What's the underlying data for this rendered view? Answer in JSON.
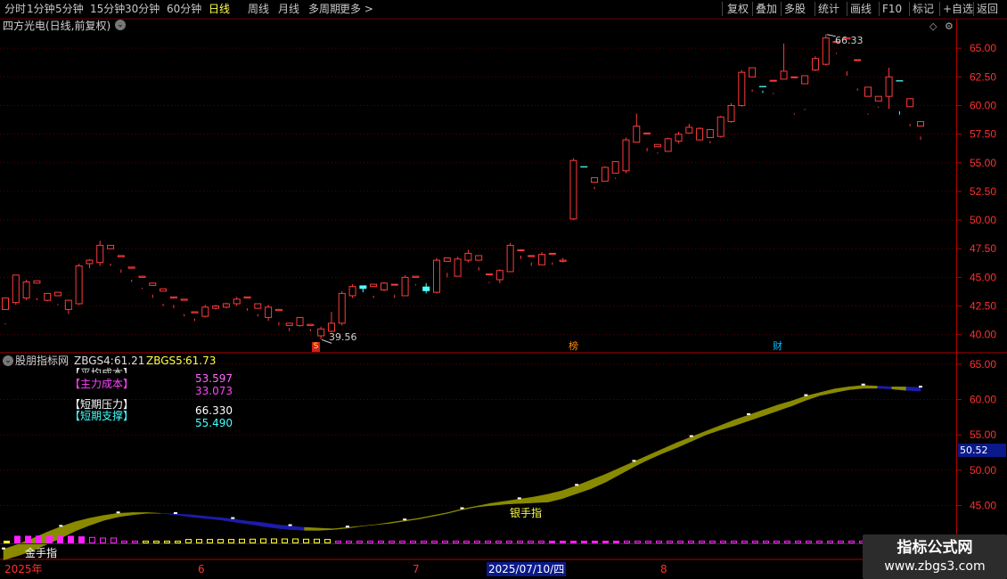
{
  "toolbar": {
    "periods": [
      "分时",
      "1分钟",
      "5分钟",
      "15分钟",
      "30分钟",
      "60分钟",
      "日线",
      "周线",
      "月线",
      "多周期",
      "更多"
    ],
    "active": "日线",
    "right": [
      "复权",
      "叠加",
      "多股",
      "统计",
      "画线",
      "F10",
      "标记",
      "+自选",
      "返回"
    ]
  },
  "main_header": {
    "title": "四方光电(日线,前复权)"
  },
  "indicator_header": {
    "name": "股朋指标网",
    "zb4_label": "ZBGS4:",
    "zb4_value": "61.21",
    "zb5_label": "ZBGS5:",
    "zb5_value": "61.73"
  },
  "info_rows": {
    "clip_label": "【平均成本】",
    "main_cost_label": "【主力成本】",
    "clip_value": "53.597",
    "main_cost_value": "33.073",
    "short_pressure_label": "【短期压力】",
    "short_support_label": "【短期支撑】",
    "short_pressure_value": "66.330",
    "short_support_value": "55.490"
  },
  "annotations": {
    "silver_label": "银手指",
    "gold_label": "金手指",
    "low_mark": "39.56",
    "high_mark": "66.33",
    "marker_s": "S",
    "marker_bang": "榜",
    "marker_cai": "财",
    "price_tag": "50.52"
  },
  "date_axis": {
    "year": "2025年",
    "m6": "6",
    "m7": "7",
    "cursor_date": "2025/07/10/四",
    "m8": "8"
  },
  "watermark": {
    "title": "指标公式网",
    "url": "www.zbgs3.com"
  },
  "colors": {
    "up": "#ff3b3b",
    "down": "#54ffff",
    "band_up": "#8a8a00",
    "band_down": "#1c1ca8",
    "grid": "#5a0000"
  },
  "chart_data": [
    {
      "type": "candlestick",
      "title": "四方光电(日线,前复权)",
      "ylim": [
        38.5,
        67.5
      ],
      "yticks": [
        40.0,
        42.5,
        45.0,
        47.5,
        50.0,
        52.5,
        55.0,
        57.5,
        60.0,
        62.5,
        65.0
      ],
      "ohlc": [
        [
          42.2,
          43.2,
          41.0,
          40.9
        ],
        [
          42.8,
          45.2,
          42.6,
          42.8
        ],
        [
          43.2,
          44.6,
          43.0,
          44.8
        ],
        [
          44.5,
          44.7,
          43.0,
          43.2
        ],
        [
          43.0,
          43.6,
          42.9,
          43.6
        ],
        [
          43.4,
          43.7,
          42.6,
          42.7
        ],
        [
          42.2,
          43.0,
          41.8,
          42.6
        ],
        [
          42.7,
          46.0,
          42.6,
          46.2
        ],
        [
          46.2,
          46.5,
          45.8,
          46.6
        ],
        [
          46.3,
          47.8,
          46.0,
          48.2
        ],
        [
          47.5,
          47.8,
          46.2,
          46.0
        ],
        [
          46.8,
          46.9,
          45.7,
          45.4
        ],
        [
          45.8,
          45.9,
          44.8,
          44.6
        ],
        [
          45.0,
          45.1,
          44.1,
          44.0
        ],
        [
          44.3,
          44.5,
          43.5,
          43.2
        ],
        [
          43.8,
          44.0,
          42.7,
          42.5
        ],
        [
          43.2,
          43.3,
          42.6,
          42.3
        ],
        [
          43.0,
          43.1,
          41.8,
          41.6
        ],
        [
          41.9,
          42.0,
          41.4,
          41.2
        ],
        [
          41.6,
          42.4,
          41.5,
          42.6
        ],
        [
          42.3,
          42.5,
          42.2,
          42.6
        ],
        [
          42.4,
          42.7,
          42.3,
          42.8
        ],
        [
          42.7,
          43.1,
          42.5,
          43.3
        ],
        [
          43.2,
          43.3,
          42.3,
          42.1
        ],
        [
          42.3,
          42.7,
          41.8,
          41.6
        ],
        [
          41.5,
          42.4,
          41.2,
          42.6
        ],
        [
          42.1,
          42.2,
          41.1,
          40.8
        ],
        [
          40.8,
          41.0,
          40.6,
          40.3
        ],
        [
          40.8,
          41.5,
          40.7,
          41.5
        ],
        [
          40.8,
          40.9,
          40.5,
          40.3
        ],
        [
          39.9,
          40.5,
          39.6,
          40.7
        ],
        [
          40.3,
          41.0,
          40.2,
          42.0
        ],
        [
          41.0,
          43.6,
          40.8,
          43.8
        ],
        [
          43.4,
          44.2,
          43.2,
          44.4
        ],
        [
          44.3,
          44.0,
          43.7,
          44.2
        ],
        [
          44.2,
          44.4,
          43.4,
          43.2
        ],
        [
          43.9,
          44.5,
          43.8,
          44.6
        ],
        [
          44.4,
          44.4,
          43.5,
          43.2
        ],
        [
          43.4,
          45.0,
          43.4,
          45.2
        ],
        [
          45.0,
          45.1,
          44.4,
          44.3
        ],
        [
          44.2,
          43.8,
          43.6,
          44.5
        ],
        [
          43.7,
          46.5,
          43.6,
          46.7
        ],
        [
          46.4,
          46.7,
          45.4,
          45.0
        ],
        [
          45.1,
          46.6,
          45.1,
          46.8
        ],
        [
          46.5,
          47.1,
          46.3,
          47.4
        ],
        [
          46.5,
          46.9,
          45.9,
          45.6
        ],
        [
          45.3,
          45.3,
          44.6,
          44.5
        ],
        [
          44.8,
          45.6,
          44.5,
          45.7
        ],
        [
          45.5,
          47.8,
          45.5,
          48.0
        ],
        [
          47.4,
          47.4,
          46.9,
          46.6
        ],
        [
          46.9,
          46.9,
          46.3,
          46.0
        ],
        [
          46.1,
          47.0,
          46.2,
          47.2
        ],
        [
          47.1,
          47.1,
          46.3,
          46.1
        ],
        [
          46.4,
          46.5,
          46.3,
          46.7
        ],
        [
          50.1,
          55.2,
          50.0,
          55.4
        ],
        [
          54.7,
          54.6,
          53.2,
          53.2
        ],
        [
          53.3,
          53.7,
          52.9,
          52.7
        ],
        [
          53.4,
          54.6,
          53.5,
          54.7
        ],
        [
          54.1,
          55.1,
          53.7,
          53.6
        ],
        [
          54.3,
          57.0,
          54.1,
          57.2
        ],
        [
          56.8,
          58.2,
          57.0,
          59.3
        ],
        [
          57.6,
          57.6,
          56.3,
          56.0
        ],
        [
          56.4,
          56.6,
          55.9,
          55.8
        ],
        [
          56.0,
          57.1,
          56.0,
          57.2
        ],
        [
          56.9,
          57.5,
          56.7,
          57.7
        ],
        [
          57.6,
          58.1,
          57.6,
          58.4
        ],
        [
          57.0,
          58.0,
          57.0,
          58.1
        ],
        [
          57.2,
          57.9,
          56.9,
          56.7
        ],
        [
          57.3,
          59.0,
          57.2,
          59.1
        ],
        [
          58.6,
          60.0,
          58.5,
          60.2
        ],
        [
          60.0,
          62.9,
          59.9,
          63.1
        ],
        [
          62.5,
          63.3,
          61.4,
          61.2
        ],
        [
          61.7,
          61.6,
          61.3,
          61.1
        ],
        [
          62.2,
          62.2,
          61.1,
          61.0
        ],
        [
          62.3,
          63.0,
          62.5,
          65.4
        ],
        [
          62.5,
          62.5,
          59.3,
          59.2
        ],
        [
          61.9,
          62.6,
          59.7,
          59.6
        ],
        [
          63.1,
          64.1,
          63.0,
          64.3
        ],
        [
          63.6,
          65.9,
          63.5,
          66.2
        ],
        [
          65.6,
          65.6,
          64.6,
          64.5
        ],
        [
          65.8,
          65.9,
          63.0,
          62.6
        ],
        [
          64.0,
          64.0,
          61.5,
          61.3
        ],
        [
          60.8,
          61.6,
          59.3,
          59.2
        ],
        [
          60.4,
          60.8,
          59.9,
          59.8
        ],
        [
          60.8,
          62.5,
          59.7,
          63.3
        ],
        [
          62.2,
          62.1,
          59.5,
          59.2
        ],
        [
          59.9,
          60.6,
          58.4,
          58.2
        ],
        [
          58.2,
          58.6,
          57.3,
          57.0
        ]
      ]
    },
    {
      "type": "area",
      "title": "股朋指标网",
      "ylim": [
        37.5,
        66.5
      ],
      "yticks": [
        40.0,
        45.0,
        50.0,
        55.0,
        60.0,
        65.0
      ],
      "series": [
        {
          "name": "ZBGS4",
          "values": [
            38.8,
            39.5,
            40.3,
            41.2,
            42.0,
            42.7,
            43.2,
            43.6,
            43.9,
            44.0,
            44.0,
            43.9,
            43.7,
            43.4,
            43.2,
            43.0,
            42.7,
            42.4,
            42.1,
            41.8,
            41.6,
            41.5,
            41.5,
            41.6,
            41.8,
            42.1,
            42.3,
            42.5,
            42.8,
            43.1,
            43.5,
            43.9,
            44.4,
            44.8,
            45.0,
            45.2,
            45.3,
            45.4,
            45.5,
            46.0,
            46.7,
            47.4,
            48.3,
            49.4,
            50.5,
            51.5,
            52.4,
            53.2,
            54.1,
            55.0,
            55.7,
            56.3,
            57.0,
            57.7,
            58.4,
            59.1,
            59.9,
            60.6,
            61.0,
            61.4,
            61.6,
            61.6,
            61.5,
            61.3,
            61.2
          ]
        },
        {
          "name": "ZBGS5",
          "values": [
            37.3,
            37.9,
            38.6,
            39.5,
            40.4,
            41.4,
            42.2,
            42.9,
            43.4,
            43.7,
            43.9,
            43.9,
            43.8,
            43.7,
            43.5,
            43.3,
            43.1,
            42.8,
            42.6,
            42.3,
            42.1,
            41.9,
            41.8,
            41.7,
            41.9,
            42.1,
            42.3,
            42.6,
            42.9,
            43.2,
            43.6,
            44.0,
            44.5,
            44.9,
            45.3,
            45.6,
            45.9,
            46.2,
            46.6,
            47.1,
            47.8,
            48.6,
            49.4,
            50.3,
            51.2,
            52.1,
            53.0,
            53.9,
            54.7,
            55.5,
            56.3,
            57.1,
            57.8,
            58.5,
            59.2,
            59.8,
            60.5,
            61.0,
            61.5,
            61.8,
            62.0,
            61.9,
            61.8,
            61.8,
            61.7
          ]
        }
      ]
    }
  ]
}
